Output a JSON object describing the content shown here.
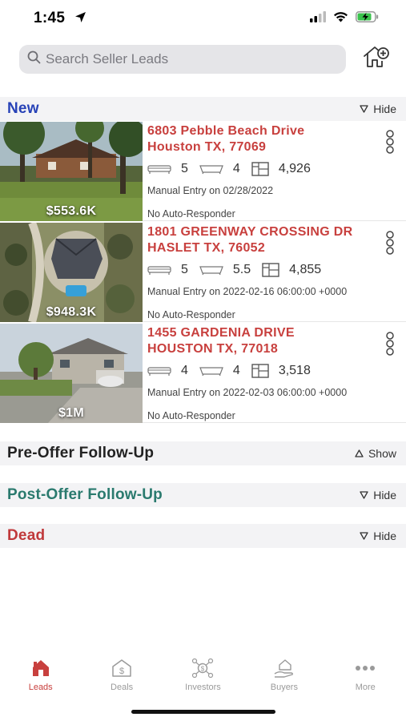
{
  "status_bar": {
    "time": "1:45"
  },
  "search": {
    "placeholder": "Search Seller Leads"
  },
  "colors": {
    "accent": "#c8403e",
    "new": "#2742b7",
    "post_offer": "#2a7a6e",
    "dead": "#c0393b"
  },
  "sections": {
    "new": {
      "title": "New",
      "toggle": "Hide"
    },
    "pre_offer": {
      "title": "Pre-Offer Follow-Up",
      "toggle": "Show"
    },
    "post_offer": {
      "title": "Post-Offer Follow-Up",
      "toggle": "Hide"
    },
    "dead": {
      "title": "Dead",
      "toggle": "Hide"
    }
  },
  "leads": [
    {
      "address_line1": "6803 Pebble Beach Drive",
      "address_line2": "Houston TX, 77069",
      "price": "$553.6K",
      "beds": "5",
      "baths": "4",
      "sqft": "4,926",
      "source": "Manual Entry on 02/28/2022",
      "responder": "No Auto-Responder"
    },
    {
      "address_line1": "1801 GREENWAY CROSSING DR",
      "address_line2": "HASLET TX, 76052",
      "price": "$948.3K",
      "beds": "5",
      "baths": "5.5",
      "sqft": "4,855",
      "source": "Manual Entry on 2022-02-16 06:00:00 +0000",
      "responder": "No Auto-Responder"
    },
    {
      "address_line1": "1455 GARDENIA DRIVE",
      "address_line2": "HOUSTON TX, 77018",
      "price": "$1M",
      "beds": "4",
      "baths": "4",
      "sqft": "3,518",
      "source": "Manual Entry on 2022-02-03 06:00:00 +0000",
      "responder": "No Auto-Responder"
    }
  ],
  "tabs": [
    {
      "label": "Leads",
      "icon": "leads-house-icon",
      "active": true
    },
    {
      "label": "Deals",
      "icon": "deals-dollar-house-icon",
      "active": false
    },
    {
      "label": "Investors",
      "icon": "investors-network-icon",
      "active": false
    },
    {
      "label": "Buyers",
      "icon": "buyers-hand-house-icon",
      "active": false
    },
    {
      "label": "More",
      "icon": "more-dots-icon",
      "active": false
    }
  ]
}
